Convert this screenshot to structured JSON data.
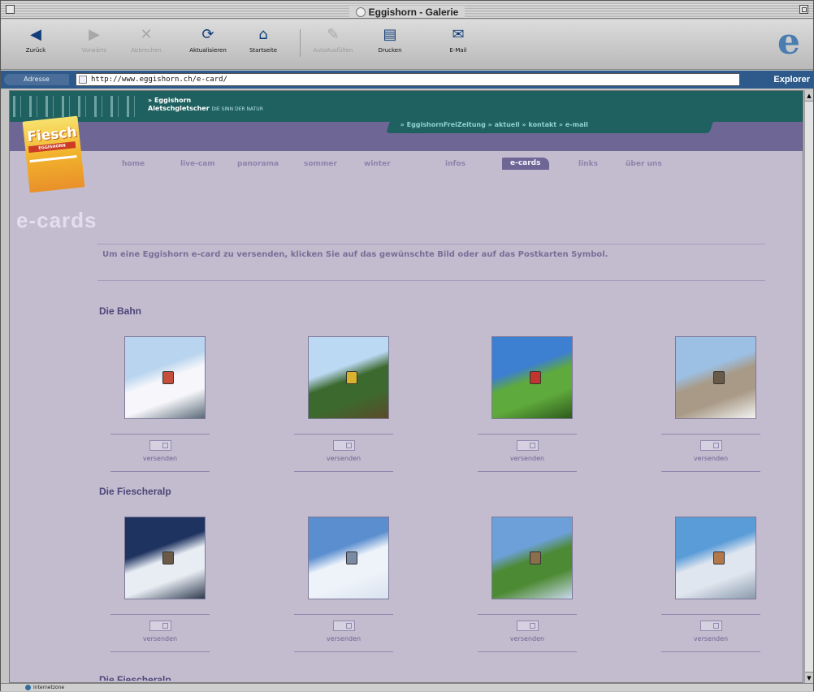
{
  "window": {
    "title": "Eggishorn - Galerie"
  },
  "toolbar": {
    "back": "Zurück",
    "forward": "Vorwärts",
    "stop": "Abbrechen",
    "refresh": "Aktualisieren",
    "home": "Startseite",
    "autofill": "AutoAusfüllen",
    "print": "Drucken",
    "mail": "E-Mail"
  },
  "address": {
    "label": "Adresse",
    "url": "http://www.eggishorn.ch/e-card/",
    "go": "Explorer"
  },
  "site": {
    "brand": "» Eggishorn",
    "brand_sub": "Aletschgletscher",
    "brand_tag": "DIE SINN DER NATUR",
    "top_links": "» EggishornFreiZeitung  » aktuell  » kontakt  » e-mail",
    "logo_name": "Fiesch",
    "logo_sub": "EGGISHORN",
    "nav": [
      "home",
      "live-cam",
      "panorama",
      "sommer",
      "winter",
      "infos",
      "e-cards",
      "links",
      "über uns"
    ],
    "nav_active": "e-cards",
    "page_title": "e-cards",
    "intro": "Um eine Eggishorn e-card zu versenden, klicken Sie auf das gewünschte Bild oder auf das Postkarten Symbol.",
    "sections": [
      {
        "title": "Die Bahn",
        "cards": [
          {
            "send": "versenden",
            "colors": [
              "#b8d4ee",
              "#f7f7fb",
              "#c74e3a",
              "#5a6a78"
            ]
          },
          {
            "send": "versenden",
            "colors": [
              "#bcd9f3",
              "#3c6a2e",
              "#d9b22e",
              "#5a4a2a"
            ]
          },
          {
            "send": "versenden",
            "colors": [
              "#3d7fd0",
              "#5faa3c",
              "#c0362e",
              "#2e5a1c"
            ]
          },
          {
            "send": "versenden",
            "colors": [
              "#9cc0e4",
              "#a89a86",
              "#6a5a48",
              "#f4f4f4"
            ]
          }
        ]
      },
      {
        "title": "Die Fiescheralp",
        "cards": [
          {
            "send": "versenden",
            "colors": [
              "#1f3360",
              "#e8edf4",
              "#6b5a48",
              "#2e3a4e"
            ]
          },
          {
            "send": "versenden",
            "colors": [
              "#5a8ecf",
              "#eef3fa",
              "#7a8aa2",
              "#d8e2ee"
            ]
          },
          {
            "send": "versenden",
            "colors": [
              "#6da0d8",
              "#4d8a34",
              "#8b6e4c",
              "#c8d8ea"
            ]
          },
          {
            "send": "versenden",
            "colors": [
              "#5a9cd8",
              "#e0e6ef",
              "#b3784a",
              "#8a9aac"
            ]
          }
        ]
      },
      {
        "title": "Die Fiescheralp"
      }
    ]
  },
  "status": {
    "zone": "Internetzone"
  }
}
